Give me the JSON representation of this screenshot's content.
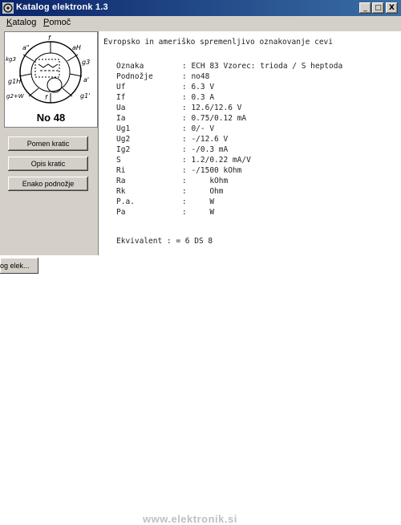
{
  "window": {
    "title": "Katalog elektronk 1.3"
  },
  "titlebar_buttons": {
    "minimize": "_",
    "maximize": "□",
    "close": "X"
  },
  "menu": {
    "items": [
      "Katalog",
      "Pomoč"
    ]
  },
  "tube": {
    "caption": "No 48",
    "pins": [
      "a\"",
      "f",
      "a\"",
      "g3",
      "a'",
      "g1\"",
      "g1'",
      "f",
      "g1H",
      "g2+W",
      "kg3"
    ]
  },
  "buttons": [
    "Pomen kratic",
    "Opis kratic",
    "Enako podnožje"
  ],
  "content": {
    "header": "Evropsko in ameriško spremenljivo oznakovanje cevi",
    "rows": [
      {
        "key": "Oznaka",
        "value": ": ECH 83 Vzorec: trioda / S heptoda"
      },
      {
        "key": "Podnožje",
        "value": ": no48"
      },
      {
        "key": "Uf",
        "value": ": 6.3 V"
      },
      {
        "key": "If",
        "value": ": 0.3 A"
      },
      {
        "key": "Ua",
        "value": ": 12.6/12.6 V"
      },
      {
        "key": "Ia",
        "value": ": 0.75/0.12 mA"
      },
      {
        "key": "Ug1",
        "value": ": 0/- V"
      },
      {
        "key": "Ug2",
        "value": ": -/12.6 V"
      },
      {
        "key": "Ig2",
        "value": ": -/0.3 mA"
      },
      {
        "key": "S",
        "value": ": 1.2/0.22 mA/V"
      },
      {
        "key": "Ri",
        "value": ": -/1500 kOhm"
      },
      {
        "key": "Ra",
        "value": ":     kOhm"
      },
      {
        "key": "Rk",
        "value": ":     Ohm"
      },
      {
        "key": "P.a.",
        "value": ":     W"
      },
      {
        "key": "Pa",
        "value": ":     W"
      }
    ],
    "equivalent": "Ekvivalent : = 6 DS 8"
  },
  "taskbar": {
    "task": "og elek..."
  },
  "watermark": "www.elektronik.si"
}
